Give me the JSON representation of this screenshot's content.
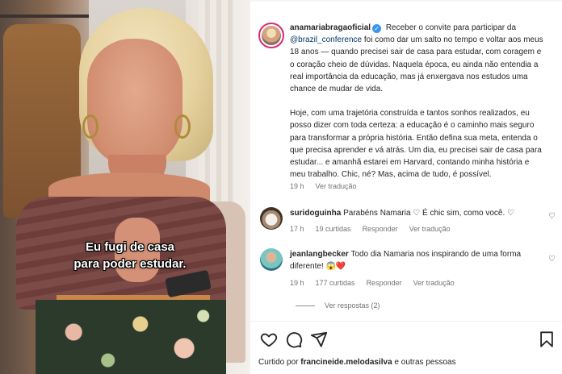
{
  "video": {
    "caption_line1": "Eu fugi de casa",
    "caption_line2": "para poder estudar."
  },
  "post": {
    "author": "anamariabragaoficial",
    "verified": true,
    "mention": "@brazil_conference",
    "p1_part1": "Receber o convite para participar da",
    "p1_part2": "foi como dar um salto no tempo e voltar aos meus 18 anos — quando precisei sair de casa para estudar, com coragem e o coração cheio de dúvidas. Naquela época, eu ainda não entendia a real importância da educação, mas já enxergava nos estudos uma chance de mudar de vida.",
    "p2": "Hoje, com uma trajetória construída e tantos sonhos realizados, eu posso dizer com toda certeza: a educação é o caminho mais seguro para transformar a própria história. Então defina sua meta, entenda o que precisa aprender e vá atrás. Um dia, eu precisei sair de casa para estudar... e amanhã estarei em Harvard, contando minha história e meu trabalho. Chic, né? Mas, acima de tudo, é possível.",
    "time": "19 h",
    "see_translation": "Ver tradução"
  },
  "comments": [
    {
      "user": "suridoguinha",
      "text": "Parabéns Namaria ♡ É chic sim, como você. ♡",
      "time": "17 h",
      "likes": "19 curtidas",
      "reply": "Responder",
      "see_translation": "Ver tradução"
    },
    {
      "user": "jeanlangbecker",
      "text": "Todo dia Namaria nos inspirando de uma forma diferente! 😱❤️",
      "time": "19 h",
      "likes": "177 curtidas",
      "reply": "Responder",
      "see_translation": "Ver tradução"
    }
  ],
  "more_replies": "Ver respostas (2)",
  "liked_by": {
    "prefix": "Curtido por",
    "user": "francineide.melodasilva",
    "suffix": "e outras pessoas"
  },
  "icons": {
    "like": "heart-icon",
    "comment": "comment-icon",
    "share": "send-icon",
    "save": "bookmark-icon"
  },
  "colors": {
    "link": "#00376b",
    "verified": "#3897f0",
    "muted": "#737373"
  }
}
